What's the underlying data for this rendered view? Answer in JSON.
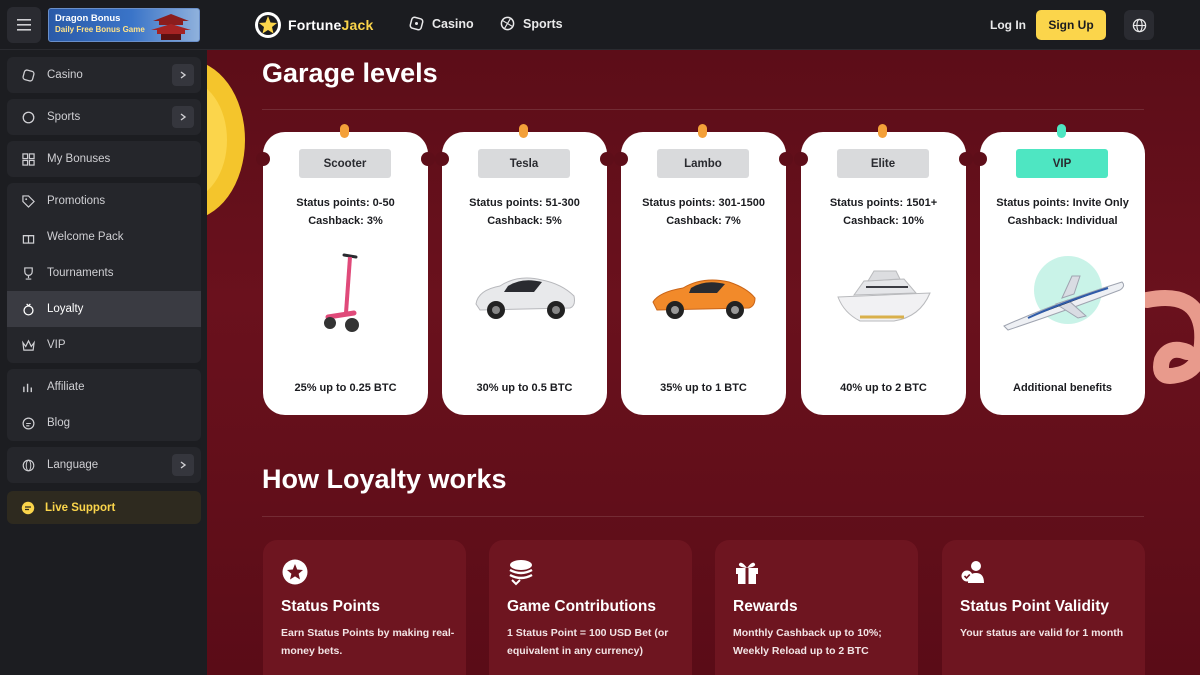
{
  "header": {
    "promo_title": "Dragon Bonus",
    "promo_subtitle": "Daily Free Bonus Game",
    "logo_fortune": "Fortune",
    "logo_jack": "Jack",
    "nav": [
      {
        "label": "Casino"
      },
      {
        "label": "Sports"
      }
    ],
    "login_label": "Log In",
    "signup_label": "Sign Up"
  },
  "sidebar": {
    "items": [
      {
        "label": "Casino"
      },
      {
        "label": "Sports"
      },
      {
        "label": "My Bonuses"
      },
      {
        "label": "Promotions"
      },
      {
        "label": "Welcome Pack"
      },
      {
        "label": "Tournaments"
      },
      {
        "label": "Loyalty"
      },
      {
        "label": "VIP"
      },
      {
        "label": "Affiliate"
      },
      {
        "label": "Blog"
      },
      {
        "label": "Language"
      }
    ],
    "live_support": "Live Support",
    "active": "Loyalty"
  },
  "garage": {
    "title": "Garage levels",
    "levels": [
      {
        "name": "Scooter",
        "points": "Status points: 0-50",
        "cashback": "Cashback: 3%",
        "reward": "25% up to 0.25 BTC",
        "icon": "scooter-icon"
      },
      {
        "name": "Tesla",
        "points": "Status points: 51-300",
        "cashback": "Cashback: 5%",
        "reward": "30% up to 0.5 BTC",
        "icon": "car-icon"
      },
      {
        "name": "Lambo",
        "points": "Status points: 301-1500",
        "cashback": "Cashback: 7%",
        "reward": "35% up to 1 BTC",
        "icon": "sports-car-icon"
      },
      {
        "name": "Elite",
        "points": "Status points: 1501+",
        "cashback": "Cashback: 10%",
        "reward": "40% up to 2 BTC",
        "icon": "yacht-icon"
      },
      {
        "name": "VIP",
        "points": "Status points: Invite Only",
        "cashback": "Cashback: Individual",
        "reward": "Additional benefits",
        "icon": "jet-icon"
      }
    ]
  },
  "how": {
    "title": "How Loyalty works",
    "cards": [
      {
        "title": "Status Points",
        "desc": "Earn Status Points by making real-money bets.",
        "icon": "star-icon"
      },
      {
        "title": "Game Contributions",
        "desc": "1 Status Point = 100 USD Bet (or equivalent in any currency)",
        "icon": "coins-icon"
      },
      {
        "title": "Rewards",
        "desc": "Monthly Cashback up to 10%; Weekly Reload up to 2 BTC",
        "icon": "gift-icon"
      },
      {
        "title": "Status Point Validity",
        "desc": "Your status are valid for 1 month",
        "icon": "user-check-icon"
      }
    ]
  },
  "colors": {
    "accent": "#fbd54b",
    "background": "#5c0d18",
    "vip_tag": "#4ee6c2",
    "pin": "#f4a039"
  }
}
